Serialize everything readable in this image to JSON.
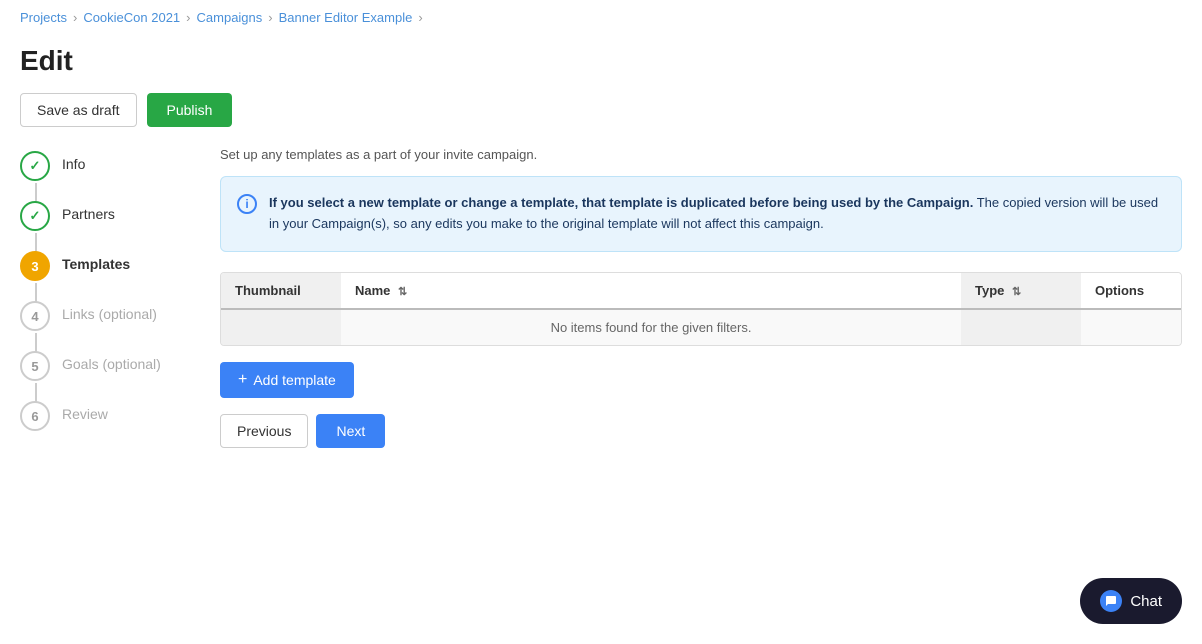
{
  "breadcrumb": {
    "items": [
      {
        "label": "Projects",
        "link": true
      },
      {
        "label": "CookieCon 2021",
        "link": true
      },
      {
        "label": "Campaigns",
        "link": true
      },
      {
        "label": "Banner Editor Example",
        "link": true,
        "current": true
      }
    ]
  },
  "page": {
    "title": "Edit"
  },
  "toolbar": {
    "save_draft_label": "Save as draft",
    "publish_label": "Publish"
  },
  "stepper": {
    "steps": [
      {
        "number": "1",
        "label": "Info",
        "state": "done"
      },
      {
        "number": "2",
        "label": "Partners",
        "state": "done"
      },
      {
        "number": "3",
        "label": "Templates",
        "state": "active"
      },
      {
        "number": "4",
        "label": "Links (optional)",
        "state": "inactive"
      },
      {
        "number": "5",
        "label": "Goals (optional)",
        "state": "inactive"
      },
      {
        "number": "6",
        "label": "Review",
        "state": "inactive"
      }
    ]
  },
  "main": {
    "intro_text": "Set up any templates as a part of your invite campaign.",
    "info_box": {
      "message": "If you select a new template or change a template, that template is duplicated before being used by the Campaign. The copied version will be used in your Campaign(s), so any edits you make to the original template will not affect this campaign."
    },
    "table": {
      "columns": [
        {
          "label": "Thumbnail",
          "sortable": false
        },
        {
          "label": "Name",
          "sortable": true
        },
        {
          "label": "Type",
          "sortable": true
        },
        {
          "label": "Options",
          "sortable": false
        }
      ],
      "empty_message": "No items found for the given filters."
    },
    "add_template_label": "+ Add template",
    "previous_label": "Previous",
    "next_label": "Next"
  },
  "chat": {
    "label": "Chat"
  }
}
